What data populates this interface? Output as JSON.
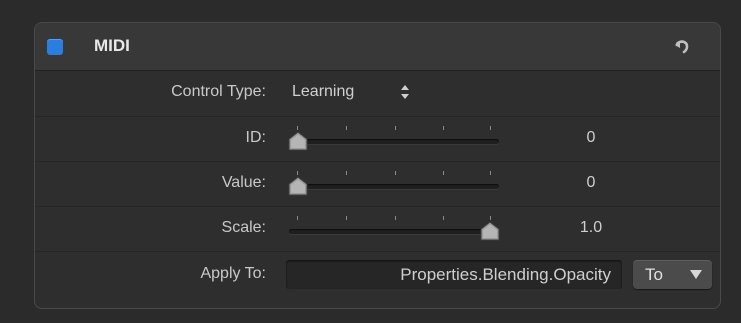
{
  "panel": {
    "title": "MIDI",
    "enabled": true,
    "accent_color": "#2a7de1",
    "reset_icon": "reset-arrow-icon"
  },
  "rows": {
    "control_type": {
      "label": "Control Type:",
      "value": "Learning",
      "icon": "updown-stepper-icon"
    },
    "id": {
      "label": "ID:",
      "value": "0",
      "slider_fraction": 0.0
    },
    "value": {
      "label": "Value:",
      "value": "0",
      "slider_fraction": 0.0
    },
    "scale": {
      "label": "Scale:",
      "value": "1.0",
      "slider_fraction": 1.0
    },
    "apply_to": {
      "label": "Apply To:",
      "value": "Properties.Blending.Opacity",
      "button_label": "To",
      "button_icon": "chevron-down-icon"
    }
  }
}
